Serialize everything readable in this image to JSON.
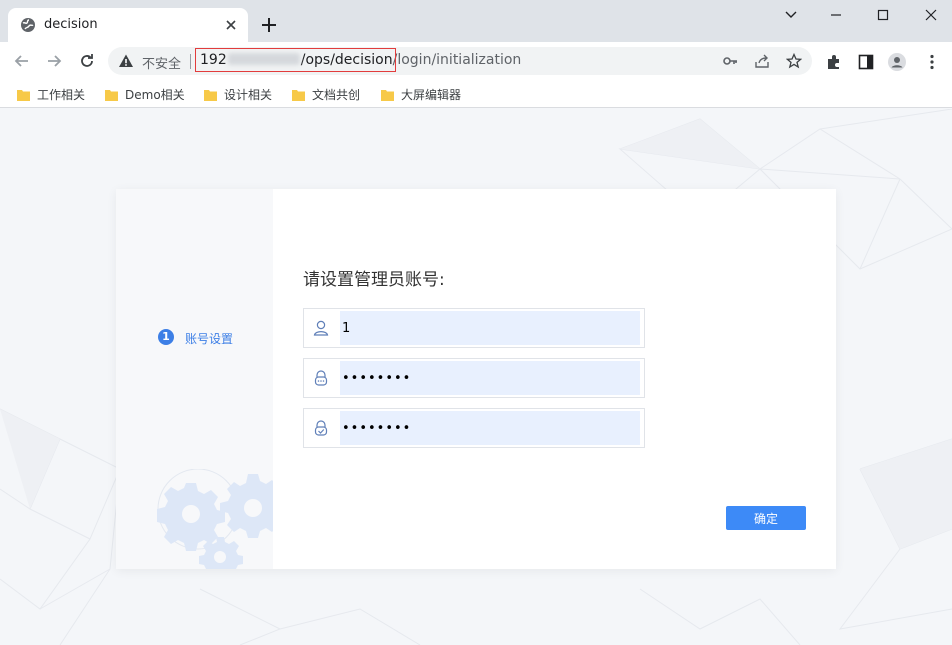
{
  "browser": {
    "tab_title": "decision",
    "insecure_label": "不安全",
    "url_host_prefix": "192",
    "url_path_highlighted": "/ops/decision",
    "url_path_rest": "/login/initialization"
  },
  "bookmarks": [
    {
      "label": "工作相关"
    },
    {
      "label": "Demo相关"
    },
    {
      "label": "设计相关"
    },
    {
      "label": "文档共创"
    },
    {
      "label": "大屏编辑器"
    }
  ],
  "steps": [
    {
      "number": "1",
      "label": "账号设置"
    }
  ],
  "form": {
    "title": "请设置管理员账号:",
    "username_value": "1",
    "password_value": "11111111",
    "confirm_password_value": "11111111",
    "confirm_button": "确定"
  },
  "colors": {
    "accent": "#3d7fe6",
    "button": "#3d8af7",
    "autofill": "#e8f0fe",
    "folder": "#f7c948"
  }
}
